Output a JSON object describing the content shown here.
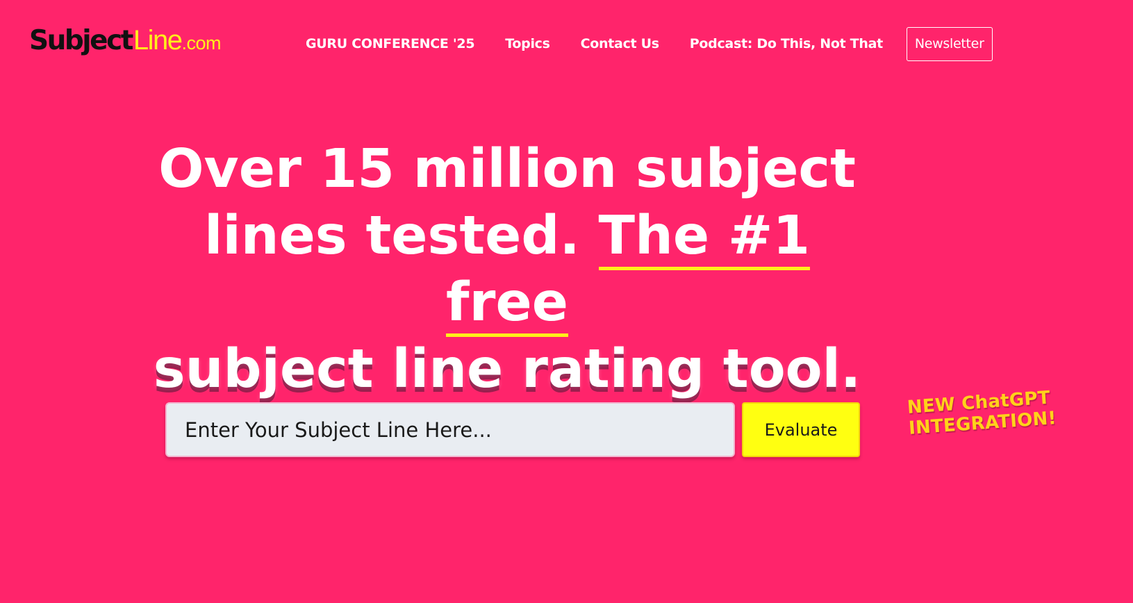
{
  "logo": {
    "part_subject": "Subject",
    "part_line": "Line",
    "part_com": ".com"
  },
  "nav": {
    "items": [
      {
        "label": "GURU CONFERENCE '25"
      },
      {
        "label": "Topics"
      },
      {
        "label": "Contact Us"
      },
      {
        "label": "Podcast: Do This, Not That"
      }
    ],
    "newsletter_label": "Newsletter"
  },
  "hero": {
    "line1": "Over 15 million subject",
    "line2_plain": "lines tested.",
    "line2_highlight": "The #1 free",
    "line3": "subject line rating tool."
  },
  "form": {
    "input_placeholder": "Enter Your Subject Line Here...",
    "input_value": "",
    "evaluate_label": "Evaluate"
  },
  "promo": {
    "line1": "NEW ChatGPT",
    "line2": "INTEGRATION!"
  },
  "colors": {
    "background": "#ff246b",
    "accent_yellow": "#fff01a",
    "button_yellow": "#ffff11",
    "promo_yellow": "#ffd21a",
    "logo_dark": "#111111"
  }
}
